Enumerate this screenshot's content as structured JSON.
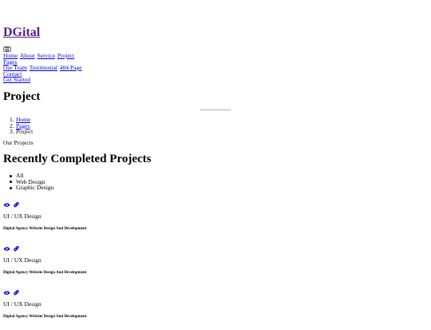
{
  "header": {
    "brand": "DGital",
    "menu_toggle": "☰"
  },
  "nav": {
    "items": [
      "Home",
      "About",
      "Service",
      "Project",
      "Pages",
      "Our Team",
      "Testimonial",
      "404 Page",
      "Contact"
    ],
    "cta": "Get Started"
  },
  "page_header": {
    "title": "Project",
    "breadcrumb": [
      "Home",
      "Pages",
      "Project"
    ]
  },
  "section": {
    "subtitle": "Our Projects",
    "title": "Recently Completed Projects",
    "filters": [
      "All",
      "Web Design",
      "Graphic Design"
    ]
  },
  "projects": [
    {
      "category": "UI / UX Design",
      "name": "Digital Agency Website Design And Development"
    },
    {
      "category": "UI / UX Design",
      "name": "Digital Agency Website Design And Development"
    },
    {
      "category": "UI / UX Design",
      "name": "Digital Agency Website Design And Development"
    }
  ],
  "colors": {
    "link": "#0000ee",
    "visited": "#551a8b"
  },
  "icons": {
    "view": "eye-icon",
    "link": "link-icon"
  }
}
